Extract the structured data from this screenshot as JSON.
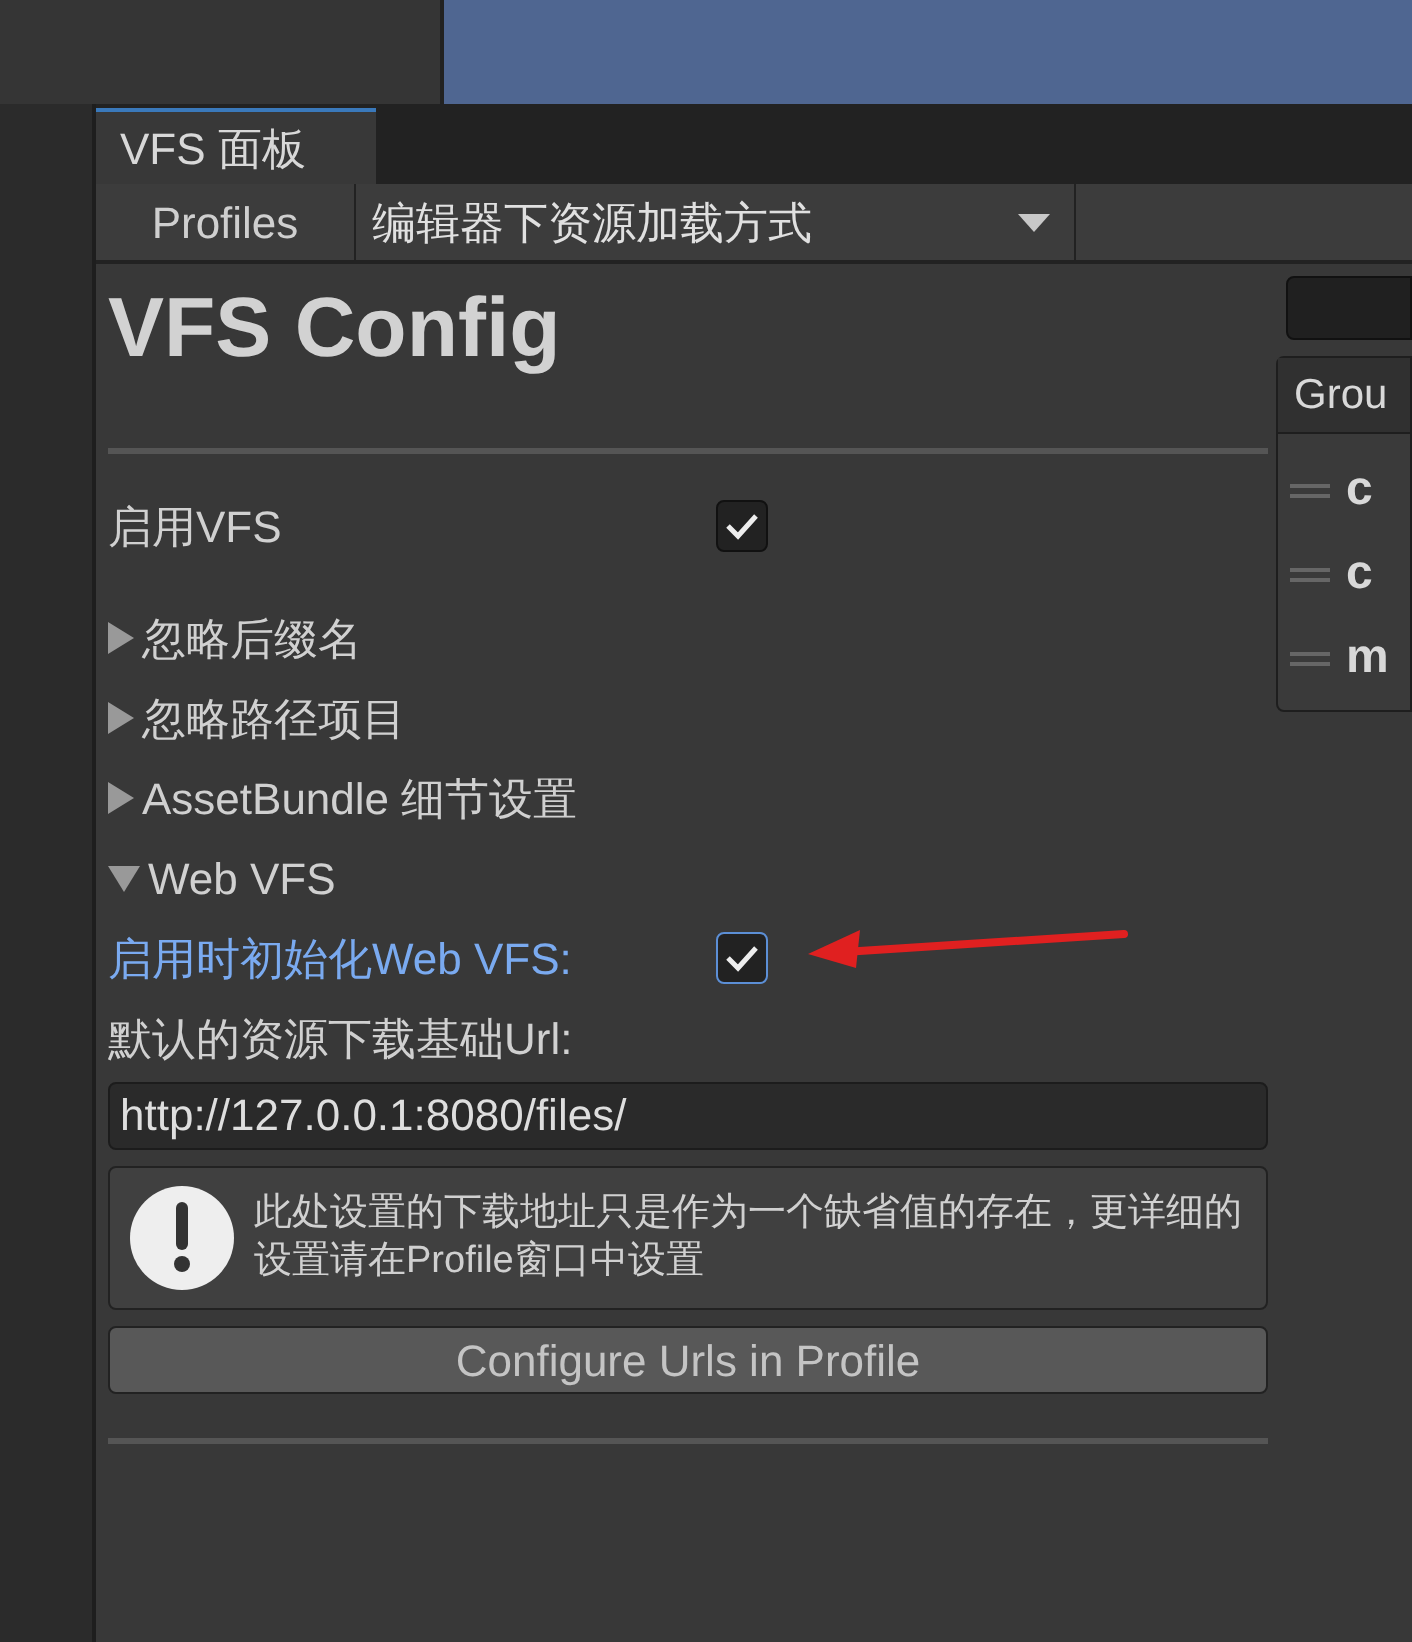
{
  "tab": {
    "label": "VFS 面板",
    "selected": true
  },
  "toolbar": {
    "profiles_button": "Profiles",
    "dropdown": "编辑器下资源加载方式"
  },
  "config": {
    "title": "VFS Config",
    "items": [
      {
        "kind": "toggle",
        "label": "启用VFS",
        "checked": true,
        "focused": false
      },
      {
        "kind": "foldout",
        "label": "忽略后缀名",
        "expanded": false
      },
      {
        "kind": "foldout",
        "label": "忽略路径项目",
        "expanded": false
      },
      {
        "kind": "foldout",
        "label": "AssetBundle 细节设置",
        "expanded": false
      },
      {
        "kind": "foldout",
        "label": "Web VFS",
        "expanded": true
      },
      {
        "kind": "toggle",
        "label": "启用时初始化Web VFS:",
        "checked": true,
        "focused": true
      },
      {
        "kind": "label",
        "label": "默认的资源下载基础Url:"
      },
      {
        "kind": "text_field",
        "value": "http://127.0.0.1:8080/files/"
      },
      {
        "kind": "help",
        "text": "此处设置的下载地址只是作为一个缺省值的存在，更详细的设置请在Profile窗口中设置"
      },
      {
        "kind": "button",
        "label": "Configure Urls in Profile"
      }
    ]
  },
  "side_panel": {
    "header": "Grou",
    "rows": [
      "c",
      "c",
      "m"
    ]
  }
}
